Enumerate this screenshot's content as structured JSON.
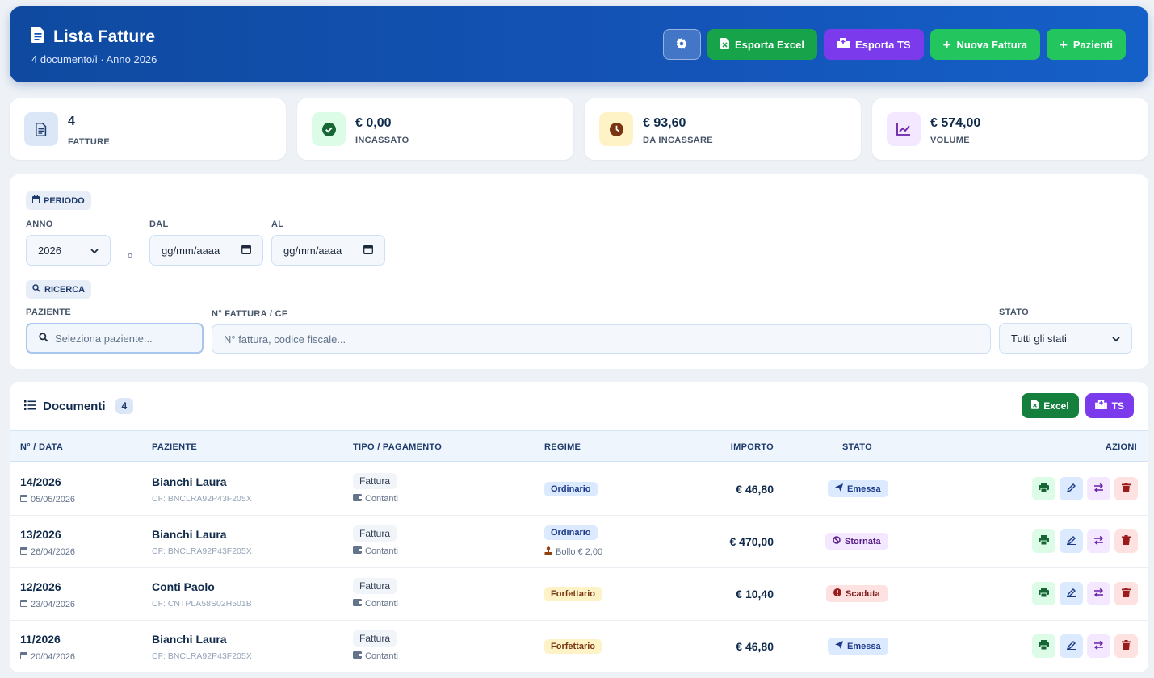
{
  "header": {
    "title": "Lista Fatture",
    "subtitle": "4 documento/i · Anno 2026",
    "buttons": {
      "excel": "Esporta Excel",
      "ts": "Esporta TS",
      "new_invoice": "Nuova Fattura",
      "patients": "Pazienti"
    }
  },
  "stats": [
    {
      "value": "4",
      "label": "FATTURE",
      "icon": "document-icon"
    },
    {
      "value": "€ 0,00",
      "label": "INCASSATO",
      "icon": "check-circle-icon"
    },
    {
      "value": "€ 93,60",
      "label": "DA INCASSARE",
      "icon": "clock-icon"
    },
    {
      "value": "€ 574,00",
      "label": "VOLUME",
      "icon": "chart-line-icon"
    }
  ],
  "filters": {
    "period_chip": "PERIODO",
    "anno_label": "ANNO",
    "anno_value": "2026",
    "or_text": "o",
    "dal_label": "DAL",
    "dal_placeholder": "gg/mm/aaaa",
    "al_label": "AL",
    "al_placeholder": "gg/mm/aaaa",
    "search_chip": "RICERCA",
    "paziente_label": "PAZIENTE",
    "paziente_placeholder": "Seleziona paziente...",
    "numero_label": "N° FATTURA / CF",
    "numero_placeholder": "N° fattura, codice fiscale...",
    "stato_label": "STATO",
    "stato_value": "Tutti gli stati"
  },
  "documents": {
    "title": "Documenti",
    "count": "4",
    "excel_btn": "Excel",
    "ts_btn": "TS",
    "columns": [
      "N° / DATA",
      "PAZIENTE",
      "TIPO / PAGAMENTO",
      "REGIME",
      "IMPORTO",
      "STATO",
      "AZIONI"
    ],
    "rows": [
      {
        "numero": "14/2026",
        "data": "05/05/2026",
        "paziente": "Bianchi Laura",
        "cf": "CF: BNCLRA92P43F205X",
        "tipo": "Fattura",
        "pagamento": "Contanti",
        "regime": "Ordinario",
        "bollo": "",
        "importo": "€ 46,80",
        "stato": "Emessa"
      },
      {
        "numero": "13/2026",
        "data": "26/04/2026",
        "paziente": "Bianchi Laura",
        "cf": "CF: BNCLRA92P43F205X",
        "tipo": "Fattura",
        "pagamento": "Contanti",
        "regime": "Ordinario",
        "bollo": "Bollo € 2,00",
        "importo": "€ 470,00",
        "stato": "Stornata"
      },
      {
        "numero": "12/2026",
        "data": "23/04/2026",
        "paziente": "Conti Paolo",
        "cf": "CF: CNTPLA58S02H501B",
        "tipo": "Fattura",
        "pagamento": "Contanti",
        "regime": "Forfettario",
        "bollo": "",
        "importo": "€ 10,40",
        "stato": "Scaduta"
      },
      {
        "numero": "11/2026",
        "data": "20/04/2026",
        "paziente": "Bianchi Laura",
        "cf": "CF: BNCLRA92P43F205X",
        "tipo": "Fattura",
        "pagamento": "Contanti",
        "regime": "Forfettario",
        "bollo": "",
        "importo": "€ 46,80",
        "stato": "Emessa"
      }
    ]
  },
  "colors": {
    "header_blue": "#1454b8",
    "green_dark": "#16a34a",
    "purple": "#7c3aed",
    "green": "#22c55e"
  }
}
